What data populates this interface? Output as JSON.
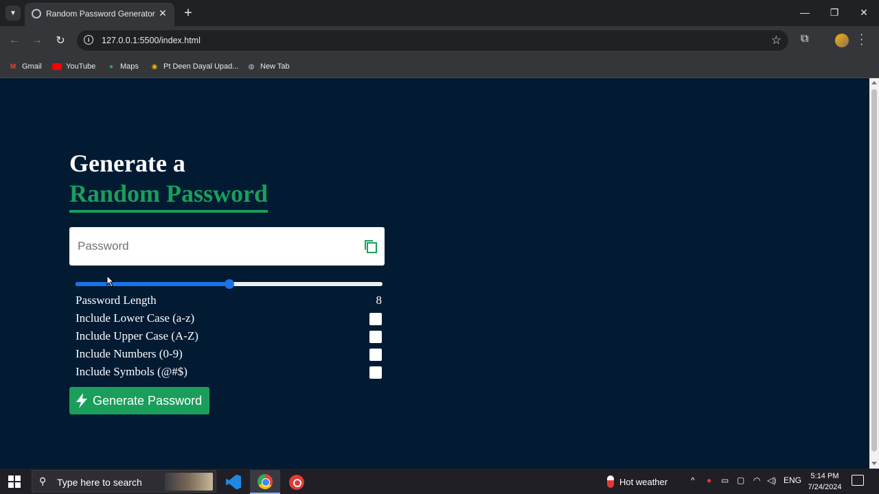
{
  "browser": {
    "tab_title": "Random Password Generator",
    "url": "127.0.0.1:5500/index.html",
    "bookmarks": [
      {
        "label": "Gmail",
        "icon": "gmail-icon"
      },
      {
        "label": "YouTube",
        "icon": "youtube-icon"
      },
      {
        "label": "Maps",
        "icon": "maps-icon"
      },
      {
        "label": "Pt Deen Dayal Upad...",
        "icon": "site-icon"
      },
      {
        "label": "New Tab",
        "icon": "globe-icon"
      }
    ]
  },
  "page": {
    "heading_line1": "Generate a",
    "heading_line2": "Random Password",
    "password_placeholder": "Password",
    "password_value": "",
    "slider": {
      "value": 8,
      "fill_fraction": 0.5
    },
    "length_label": "Password Length",
    "length_value": "8",
    "options": [
      {
        "label": "Include Lower Case (a-z)",
        "checked": false
      },
      {
        "label": "Include Upper Case (A-Z)",
        "checked": false
      },
      {
        "label": "Include Numbers (0-9)",
        "checked": false
      },
      {
        "label": "Include Symbols (@#$)",
        "checked": false
      }
    ],
    "generate_button": "Generate Password",
    "colors": {
      "background": "#021b33",
      "accent": "#1a9e5c",
      "slider": "#1a73e8"
    }
  },
  "taskbar": {
    "search_placeholder": "Type here to search",
    "weather": "Hot weather",
    "language": "ENG",
    "time": "5:14 PM",
    "date": "7/24/2024"
  }
}
